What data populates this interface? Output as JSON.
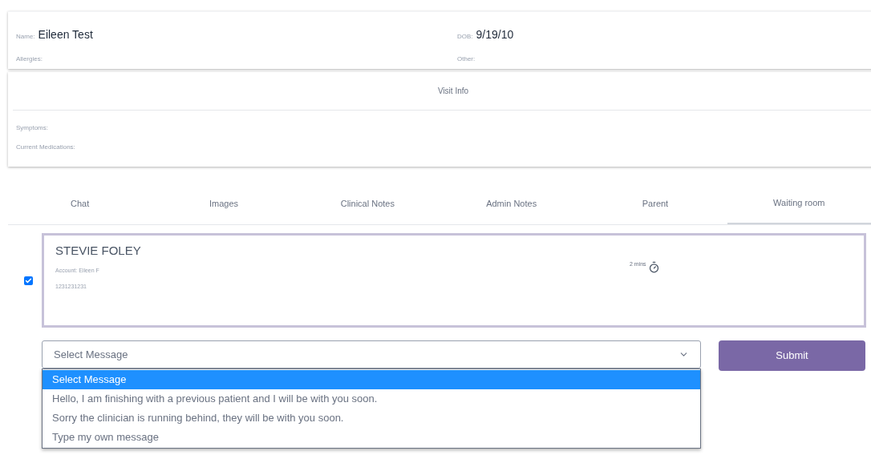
{
  "patient": {
    "name_label": "Name:",
    "name": "Eileen Test",
    "dob_label": "DOB:",
    "dob": "9/19/10",
    "allergies_label": "Allergies:",
    "other_label": "Other:"
  },
  "visit": {
    "title": "Visit Info",
    "symptoms_label": "Symptoms:",
    "medications_label": "Current Medications:"
  },
  "tabs": [
    {
      "label": "Chat",
      "selected": false
    },
    {
      "label": "Images",
      "selected": false
    },
    {
      "label": "Clinical Notes",
      "selected": false
    },
    {
      "label": "Admin Notes",
      "selected": false
    },
    {
      "label": "Parent",
      "selected": false
    },
    {
      "label": "Waiting room",
      "selected": true
    }
  ],
  "waiting": {
    "checked": true,
    "name": "STEVIE FOLEY",
    "account": "Account: Eileen F",
    "phone": "1231231231",
    "wait": "2 mins"
  },
  "message_select": {
    "value": "Select Message",
    "options": [
      {
        "label": "Select Message",
        "selected": true
      },
      {
        "label": "Hello, I am finishing with a previous patient and I will be with you soon.",
        "selected": false
      },
      {
        "label": "Sorry the clinician is running behind, they will be with you soon.",
        "selected": false
      },
      {
        "label": "Type my own message",
        "selected": false
      }
    ]
  },
  "submit": "Submit"
}
